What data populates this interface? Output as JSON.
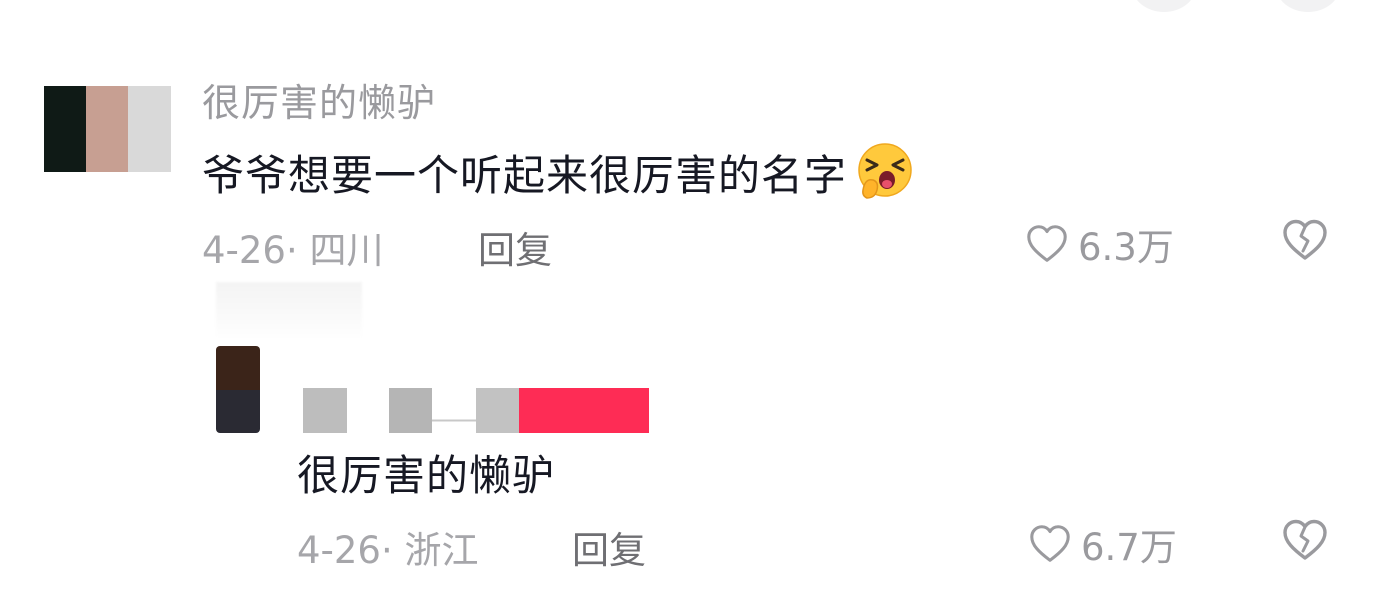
{
  "comment": {
    "username": "很厉害的懒驴",
    "text": "爷爷想要一个听起来很厉害的名字",
    "emoji_icon": "yawning-face-emoji",
    "date_location": "4-26· 四川",
    "reply_label": "回复",
    "likes": "6.3万"
  },
  "reply": {
    "text": "很厉害的懒驴",
    "date_location": "4-26· 浙江",
    "reply_label": "回复",
    "likes": "6.7万"
  },
  "colors": {
    "text_primary": "#161823",
    "text_secondary": "#9a9a9e",
    "accent_badge": "#fe2c55"
  }
}
